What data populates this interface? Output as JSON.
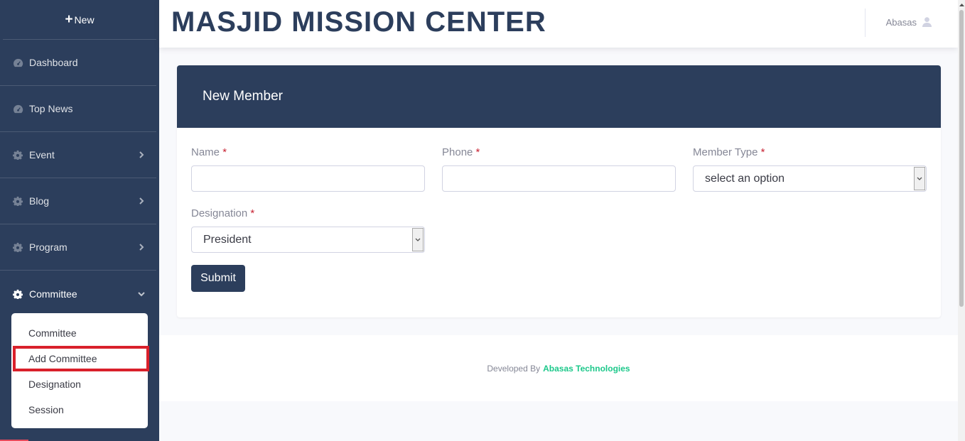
{
  "sidebar": {
    "new_label": "New",
    "items": [
      {
        "label": "Dashboard",
        "icon": "dashboard-icon",
        "has_chevron": false
      },
      {
        "label": "Top News",
        "icon": "dashboard-icon",
        "has_chevron": false
      },
      {
        "label": "Event",
        "icon": "gear-icon",
        "has_chevron": true
      },
      {
        "label": "Blog",
        "icon": "gear-icon",
        "has_chevron": true
      },
      {
        "label": "Program",
        "icon": "gear-icon",
        "has_chevron": true
      },
      {
        "label": "Committee",
        "icon": "gear-icon",
        "has_chevron": true,
        "expanded": true
      }
    ],
    "submenu": [
      {
        "label": "Committee"
      },
      {
        "label": "Add Committee",
        "highlighted": true
      },
      {
        "label": "Designation"
      },
      {
        "label": "Session"
      }
    ]
  },
  "header": {
    "brand": "MASJID MISSION CENTER",
    "user_name": "Abasas"
  },
  "form": {
    "title": "New Member",
    "name_label": "Name",
    "phone_label": "Phone",
    "member_type_label": "Member Type",
    "member_type_value": "select an option",
    "designation_label": "Designation",
    "designation_value": "President",
    "required_mark": "*",
    "submit_label": "Submit"
  },
  "footer": {
    "prefix": "Developed By",
    "company": "Abasas Technologies"
  },
  "colors": {
    "primary": "#2c3e5c",
    "highlight": "#d9202b",
    "footer_link": "#1cc88a",
    "required": "#c82333"
  }
}
